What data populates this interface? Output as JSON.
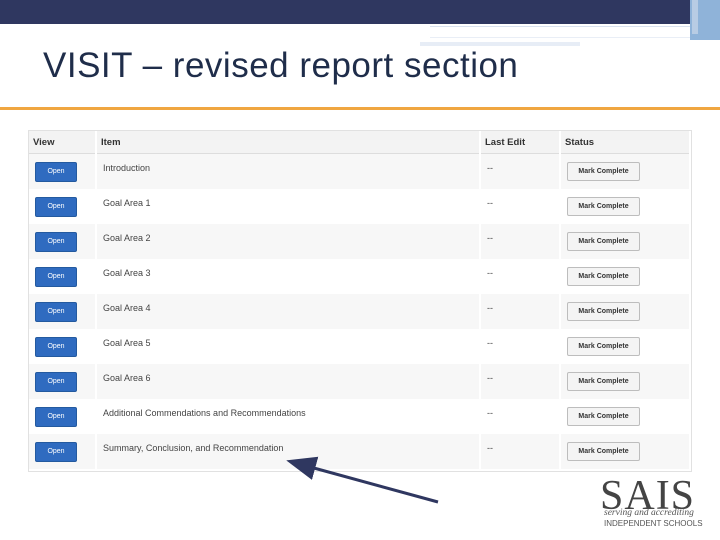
{
  "slide": {
    "title": "VISIT – revised report section"
  },
  "table": {
    "headers": {
      "view": "View",
      "item": "Item",
      "last_edit": "Last Edit",
      "status": "Status"
    },
    "rows": [
      {
        "open": "Open",
        "item": "Introduction",
        "last_edit": "--",
        "status": "Mark Complete"
      },
      {
        "open": "Open",
        "item": "Goal Area 1",
        "last_edit": "--",
        "status": "Mark Complete"
      },
      {
        "open": "Open",
        "item": "Goal Area 2",
        "last_edit": "--",
        "status": "Mark Complete"
      },
      {
        "open": "Open",
        "item": "Goal Area 3",
        "last_edit": "--",
        "status": "Mark Complete"
      },
      {
        "open": "Open",
        "item": "Goal Area 4",
        "last_edit": "--",
        "status": "Mark Complete"
      },
      {
        "open": "Open",
        "item": "Goal Area 5",
        "last_edit": "--",
        "status": "Mark Complete"
      },
      {
        "open": "Open",
        "item": "Goal Area 6",
        "last_edit": "--",
        "status": "Mark Complete"
      },
      {
        "open": "Open",
        "item": "Additional Commendations and Recommendations",
        "last_edit": "--",
        "status": "Mark Complete"
      },
      {
        "open": "Open",
        "item": "Summary, Conclusion, and Recommendation",
        "last_edit": "--",
        "status": "Mark Complete"
      }
    ]
  },
  "logo": {
    "main": "SAIS",
    "sub1": "serving and accrediting",
    "sub2": "INDEPENDENT SCHOOLS"
  },
  "colors": {
    "header_bar": "#2f3760",
    "title_rule": "#f0a640",
    "open_button": "#2f6bc0",
    "arrow": "#2f3760"
  }
}
